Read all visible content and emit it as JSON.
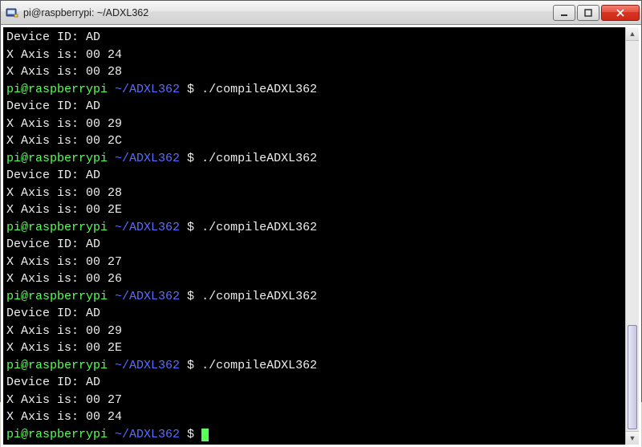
{
  "titlebar": {
    "title": "pi@raspberrypi: ~/ADXL362"
  },
  "prompt": {
    "user_host": "pi@raspberrypi",
    "path": "~/ADXL362",
    "sep": " $ "
  },
  "command": "./compileADXL362",
  "runs": [
    {
      "has_prompt_before": false,
      "output": [
        "Device ID: AD",
        "X Axis is: 00 24",
        "X Axis is: 00 28"
      ]
    },
    {
      "has_prompt_before": true,
      "output": [
        "Device ID: AD",
        "X Axis is: 00 29",
        "X Axis is: 00 2C"
      ]
    },
    {
      "has_prompt_before": true,
      "output": [
        "Device ID: AD",
        "X Axis is: 00 28",
        "X Axis is: 00 2E"
      ]
    },
    {
      "has_prompt_before": true,
      "output": [
        "Device ID: AD",
        "X Axis is: 00 27",
        "X Axis is: 00 26"
      ]
    },
    {
      "has_prompt_before": true,
      "output": [
        "Device ID: AD",
        "X Axis is: 00 29",
        "X Axis is: 00 2E"
      ]
    },
    {
      "has_prompt_before": true,
      "output": [
        "Device ID: AD",
        "X Axis is: 00 27",
        "X Axis is: 00 24"
      ]
    }
  ],
  "final_prompt": true
}
